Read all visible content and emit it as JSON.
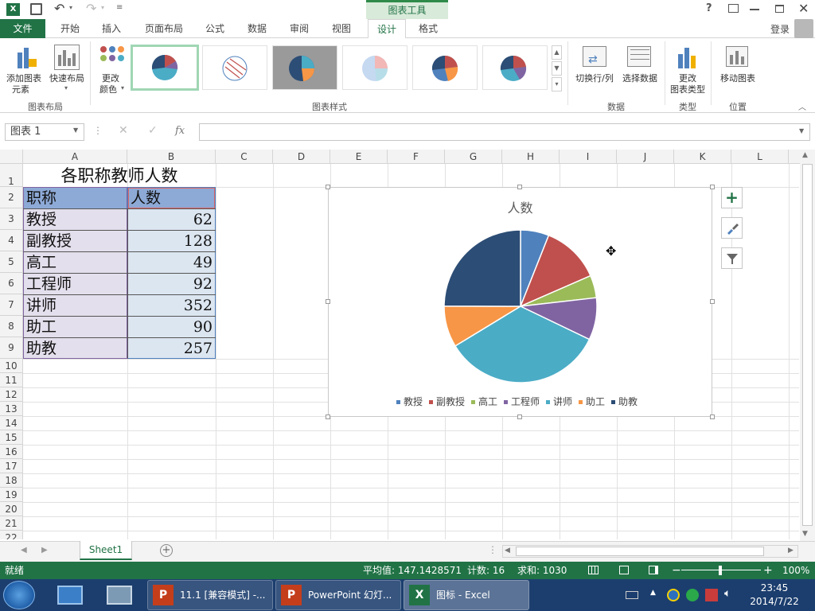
{
  "window": {
    "title": "图标 - Excel",
    "help": "?",
    "login": "登录"
  },
  "context_tab": "图表工具",
  "tabs": [
    {
      "label": "文件"
    },
    {
      "label": "开始"
    },
    {
      "label": "插入"
    },
    {
      "label": "页面布局"
    },
    {
      "label": "公式"
    },
    {
      "label": "数据"
    },
    {
      "label": "审阅"
    },
    {
      "label": "视图"
    },
    {
      "label": "设计"
    },
    {
      "label": "格式"
    }
  ],
  "ribbon": {
    "add_element": [
      "添加图表",
      "元素"
    ],
    "quick_layout": "快速布局",
    "change_color": [
      "更改",
      "颜色"
    ],
    "switch_rowcol": "切换行/列",
    "select_data": "选择数据",
    "change_type": [
      "更改",
      "图表类型"
    ],
    "move_chart": "移动图表",
    "groups": {
      "layout": "图表布局",
      "styles": "图表样式",
      "data": "数据",
      "type": "类型",
      "location": "位置"
    }
  },
  "formula_bar": {
    "name_box": "图表 1",
    "fx": "fx",
    "value": ""
  },
  "columns": [
    "A",
    "B",
    "C",
    "D",
    "E",
    "F",
    "G",
    "H",
    "I",
    "J",
    "K",
    "L"
  ],
  "rows": [
    "1",
    "2",
    "3",
    "4",
    "5",
    "6",
    "7",
    "8",
    "9",
    "10",
    "11",
    "12",
    "13",
    "14",
    "15",
    "16",
    "17",
    "18",
    "19",
    "20",
    "21",
    "22"
  ],
  "sheet": {
    "title": "各职称教师人数",
    "header": {
      "a": "职称",
      "b": "人数"
    },
    "data": [
      {
        "name": "教授",
        "count": "62"
      },
      {
        "name": "副教授",
        "count": "128"
      },
      {
        "name": "高工",
        "count": "49"
      },
      {
        "name": "工程师",
        "count": "92"
      },
      {
        "name": "讲师",
        "count": "352"
      },
      {
        "name": "助工",
        "count": "90"
      },
      {
        "name": "助教",
        "count": "257"
      }
    ]
  },
  "chart_data": {
    "type": "pie",
    "title": "人数",
    "categories": [
      "教授",
      "副教授",
      "高工",
      "工程师",
      "讲师",
      "助工",
      "助教"
    ],
    "values": [
      62,
      128,
      49,
      92,
      352,
      90,
      257
    ],
    "colors": [
      "#4f81bd",
      "#c0504d",
      "#9bbb59",
      "#8064a2",
      "#4bacc6",
      "#f79646",
      "#2c4d75"
    ],
    "legend": "bottom"
  },
  "sheet_tabs": [
    "Sheet1"
  ],
  "status": {
    "ready": "就绪",
    "average": "平均值: 147.1428571",
    "count": "计数: 16",
    "sum": "求和: 1030",
    "zoom": "100%"
  },
  "taskbar": {
    "items": [
      "11.1 [兼容模式] -...",
      "PowerPoint 幻灯...",
      "图标 - Excel"
    ],
    "time": "23:45",
    "date": "2014/7/22"
  }
}
